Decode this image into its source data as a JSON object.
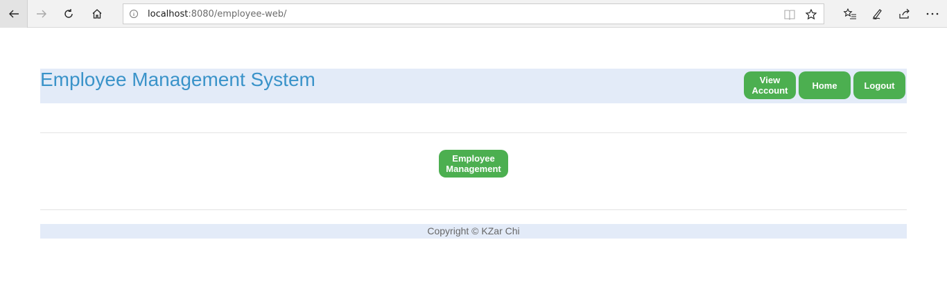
{
  "browser": {
    "url_host": "localhost",
    "url_rest": ":8080/employee-web/",
    "icons": [
      "back-icon",
      "forward-icon",
      "refresh-icon",
      "home-icon",
      "info-icon",
      "reading-view-icon",
      "favorite-star-icon",
      "favorites-list-icon",
      "pen-icon",
      "share-icon",
      "more-icon"
    ]
  },
  "header": {
    "title": "Employee Management System",
    "buttons": {
      "view_account_line1": "View",
      "view_account_line2": "Account",
      "home": "Home",
      "logout": "Logout"
    }
  },
  "main": {
    "employee_management_line1": "Employee",
    "employee_management_line2": "Management"
  },
  "footer": {
    "copyright": "Copyright © KZar Chi"
  },
  "colors": {
    "accent_green": "#4caf50",
    "title_blue": "#3a93c9",
    "header_bg": "#e3ebf8"
  }
}
